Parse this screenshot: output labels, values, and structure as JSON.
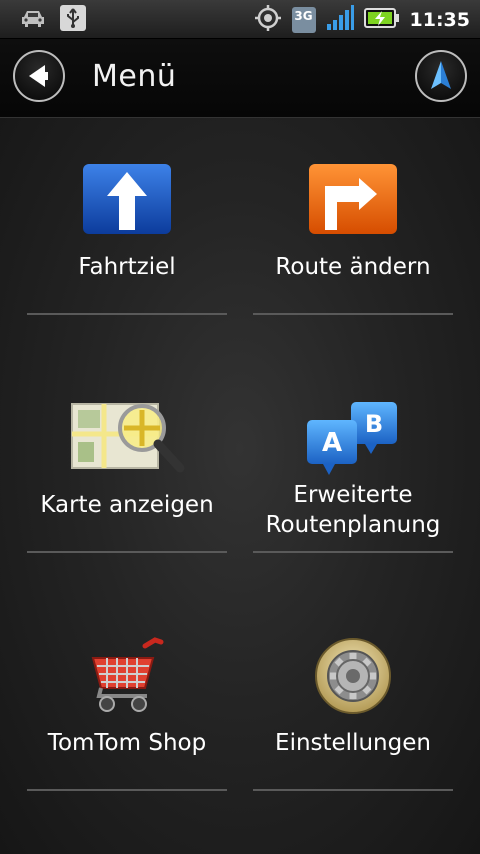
{
  "status_bar": {
    "icons_left": [
      "car-icon",
      "usb-icon"
    ],
    "icons_right": [
      "gps-icon",
      "3g-badge",
      "signal-icon",
      "battery-charging-icon"
    ],
    "network": "3G",
    "time": "11:35"
  },
  "header": {
    "title": "Menü",
    "back_icon": "back-arrow-icon",
    "nav_icon": "navigation-arrow-icon"
  },
  "menu": {
    "items": [
      {
        "label": "Fahrtziel",
        "icon": "destination-arrow-icon"
      },
      {
        "label": "Route ändern",
        "icon": "change-route-icon"
      },
      {
        "label": "Karte anzeigen",
        "icon": "map-magnifier-icon"
      },
      {
        "label": "Erweiterte\nRoutenplanung",
        "icon": "ab-route-planning-icon"
      },
      {
        "label": "TomTom Shop",
        "icon": "shopping-cart-icon"
      },
      {
        "label": "Einstellungen",
        "icon": "settings-gear-icon"
      }
    ]
  },
  "colors": {
    "blue_icon": "#1f5cc8",
    "orange_icon": "#ee6a10",
    "nav_arrow": "#4aa8f0",
    "battery_green": "#7ed321"
  }
}
